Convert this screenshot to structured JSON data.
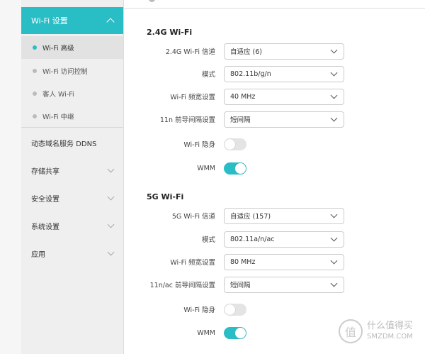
{
  "sidebar": {
    "header": "Wi-Fi 设置",
    "subitems": [
      "Wi-Fi 高级",
      "Wi-Fi 访问控制",
      "客人 Wi-Fi",
      "Wi-Fi 中继"
    ],
    "items": [
      "动态域名服务 DDNS",
      "存储共享",
      "安全设置",
      "系统设置",
      "应用"
    ]
  },
  "g24": {
    "title": "2.4G Wi-Fi",
    "rows": [
      {
        "label": "2.4G Wi-Fi 信道",
        "value": "自适应 (6)"
      },
      {
        "label": "模式",
        "value": "802.11b/g/n"
      },
      {
        "label": "Wi-Fi 频宽设置",
        "value": "40 MHz"
      },
      {
        "label": "11n 前导间隔设置",
        "value": "短间隔"
      }
    ],
    "hidden_label": "Wi-Fi 隐身",
    "hidden_on": false,
    "wmm_label": "WMM",
    "wmm_on": true
  },
  "g5": {
    "title": "5G Wi-Fi",
    "rows": [
      {
        "label": "5G Wi-Fi 信道",
        "value": "自适应 (157)"
      },
      {
        "label": "模式",
        "value": "802.11a/n/ac"
      },
      {
        "label": "Wi-Fi 频宽设置",
        "value": "80 MHz"
      },
      {
        "label": "11n/ac 前导间隔设置",
        "value": "短间隔"
      }
    ],
    "hidden_label": "Wi-Fi 隐身",
    "hidden_on": false,
    "wmm_label": "WMM",
    "wmm_on": true
  },
  "watermark": {
    "logo": "值",
    "name": "什么值得买",
    "site": "SMZDM.COM"
  },
  "colors": {
    "accent": "#29bdc6"
  }
}
